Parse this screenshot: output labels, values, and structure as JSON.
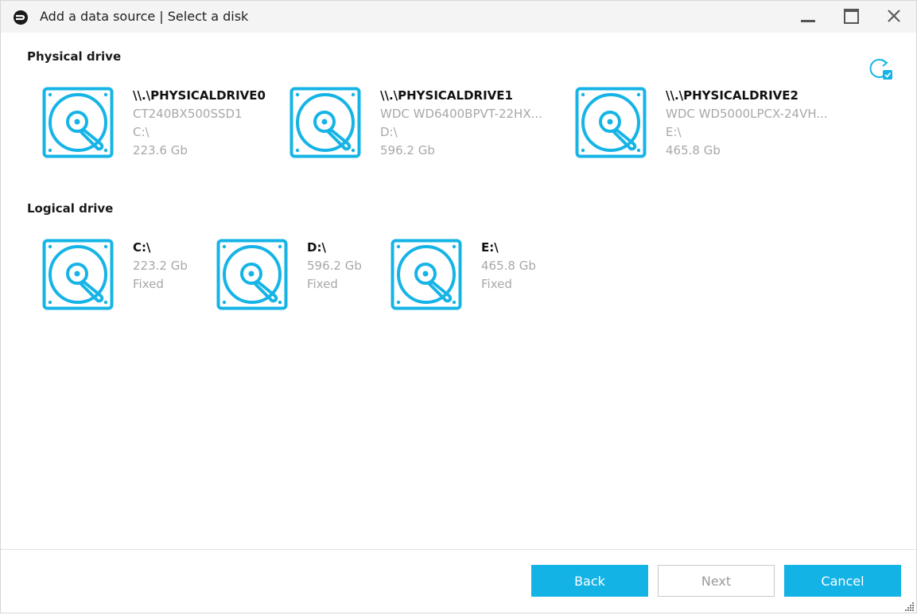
{
  "window": {
    "title": "Add a data source | Select a disk"
  },
  "sections": {
    "physical_title": "Physical drive",
    "logical_title": "Logical drive"
  },
  "physical_drives": [
    {
      "name": "\\\\.\\PHYSICALDRIVE0",
      "model": "CT240BX500SSD1",
      "letter": "C:\\",
      "size": "223.6 Gb"
    },
    {
      "name": "\\\\.\\PHYSICALDRIVE1",
      "model": "WDC WD6400BPVT-22HX...",
      "letter": "D:\\",
      "size": "596.2 Gb"
    },
    {
      "name": "\\\\.\\PHYSICALDRIVE2",
      "model": "WDC WD5000LPCX-24VH...",
      "letter": "E:\\",
      "size": "465.8 Gb"
    }
  ],
  "logical_drives": [
    {
      "name": "C:\\",
      "size": "223.2 Gb",
      "type": "Fixed"
    },
    {
      "name": "D:\\",
      "size": "596.2 Gb",
      "type": "Fixed"
    },
    {
      "name": "E:\\",
      "size": "465.8 Gb",
      "type": "Fixed"
    }
  ],
  "buttons": {
    "back": "Back",
    "next": "Next",
    "cancel": "Cancel"
  },
  "icons": {
    "app": "app-logo-icon",
    "drive": "hard-drive-icon",
    "refresh": "refresh-icon",
    "minimize": "minimize-icon",
    "maximize": "maximize-icon",
    "close": "close-icon",
    "grip": "resize-grip-icon"
  },
  "colors": {
    "accent": "#14b3e6",
    "drive_icon": "#16b4e6",
    "muted_text": "#a8a8a8",
    "titlebar": "#f4f4f4"
  }
}
